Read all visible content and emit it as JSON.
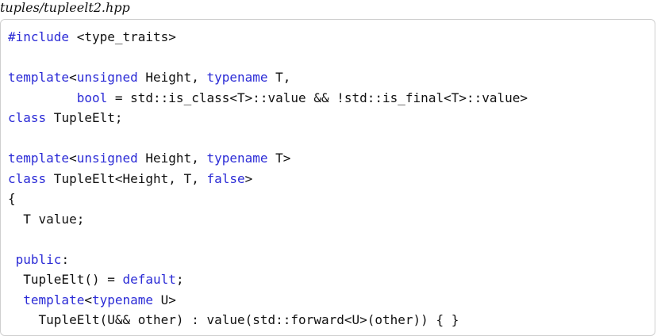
{
  "filename": "tuples/tupleelt2.hpp",
  "colors": {
    "keyword": "#2b2bd6",
    "text": "#111111",
    "border": "#cfcfcf"
  },
  "code_lines": [
    [
      {
        "t": "#include",
        "k": "pp"
      },
      {
        "t": " <type_traits>",
        "k": "plain"
      }
    ],
    [],
    [
      {
        "t": "template",
        "k": "kw"
      },
      {
        "t": "<",
        "k": "plain"
      },
      {
        "t": "unsigned",
        "k": "kw"
      },
      {
        "t": " Height, ",
        "k": "plain"
      },
      {
        "t": "typename",
        "k": "kw"
      },
      {
        "t": " T,",
        "k": "plain"
      }
    ],
    [
      {
        "t": "         ",
        "k": "plain"
      },
      {
        "t": "bool",
        "k": "kw"
      },
      {
        "t": " = std::is_class<T>::value && !std::is_final<T>::value>",
        "k": "plain"
      }
    ],
    [
      {
        "t": "class",
        "k": "kw"
      },
      {
        "t": " TupleElt;",
        "k": "plain"
      }
    ],
    [],
    [
      {
        "t": "template",
        "k": "kw"
      },
      {
        "t": "<",
        "k": "plain"
      },
      {
        "t": "unsigned",
        "k": "kw"
      },
      {
        "t": " Height, ",
        "k": "plain"
      },
      {
        "t": "typename",
        "k": "kw"
      },
      {
        "t": " T>",
        "k": "plain"
      }
    ],
    [
      {
        "t": "class",
        "k": "kw"
      },
      {
        "t": " TupleElt<Height, T, ",
        "k": "plain"
      },
      {
        "t": "false",
        "k": "kw"
      },
      {
        "t": ">",
        "k": "plain"
      }
    ],
    [
      {
        "t": "{",
        "k": "plain"
      }
    ],
    [
      {
        "t": "  T value;",
        "k": "plain"
      }
    ],
    [],
    [
      {
        "t": " ",
        "k": "plain"
      },
      {
        "t": "public",
        "k": "kw"
      },
      {
        "t": ":",
        "k": "plain"
      }
    ],
    [
      {
        "t": "  TupleElt() = ",
        "k": "plain"
      },
      {
        "t": "default",
        "k": "kw"
      },
      {
        "t": ";",
        "k": "plain"
      }
    ],
    [
      {
        "t": "  ",
        "k": "plain"
      },
      {
        "t": "template",
        "k": "kw"
      },
      {
        "t": "<",
        "k": "plain"
      },
      {
        "t": "typename",
        "k": "kw"
      },
      {
        "t": " U>",
        "k": "plain"
      }
    ],
    [
      {
        "t": "    TupleElt(U&& other) : value(std::forward<U>(other)) { }",
        "k": "plain"
      }
    ]
  ]
}
